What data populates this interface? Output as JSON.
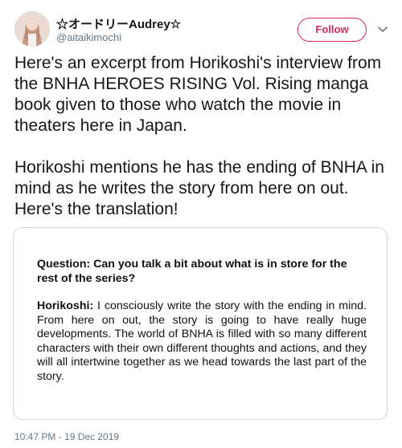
{
  "author": {
    "display_name": "☆オードリーAudrey☆",
    "handle": "@aitaikimochi",
    "follow_label": "Follow",
    "avatar_icon": "avatar-photo",
    "menu_icon": "chevron-down-icon",
    "accent_color": "#e0245e"
  },
  "tweet": {
    "paragraph_1": "Here's an excerpt from Horikoshi's interview from the BNHA HEROES RISING Vol. Rising manga book given to those who watch the movie in theaters here in Japan.",
    "paragraph_2": "Horikoshi mentions he has the ending of BNHA in mind as he writes the story from here on out. Here's the translation!",
    "timestamp": "10:47 PM - 19 Dec 2019"
  },
  "card": {
    "question": "Question: Can you talk a bit about what is in store for the rest of the series?",
    "answer_speaker": "Horikoshi:",
    "answer_text": " I consciously write the story with the ending in mind. From here on out, the story is going to have really huge developments. The world of BNHA is filled with so many different characters with their own different thoughts and actions, and they will all intertwine together as we head towards the last part of the story."
  }
}
